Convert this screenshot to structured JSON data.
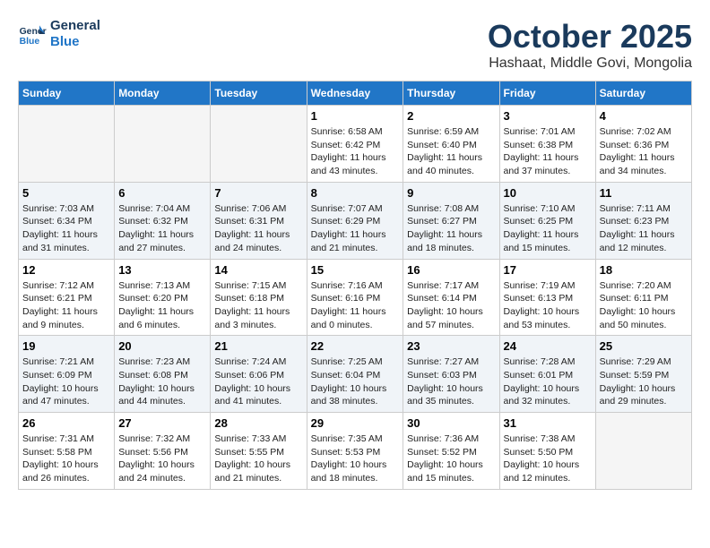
{
  "header": {
    "logo_line1": "General",
    "logo_line2": "Blue",
    "month_title": "October 2025",
    "location": "Hashaat, Middle Govi, Mongolia"
  },
  "days_of_week": [
    "Sunday",
    "Monday",
    "Tuesday",
    "Wednesday",
    "Thursday",
    "Friday",
    "Saturday"
  ],
  "weeks": [
    [
      {
        "day": "",
        "empty": true
      },
      {
        "day": "",
        "empty": true
      },
      {
        "day": "",
        "empty": true
      },
      {
        "day": "1",
        "sunrise": "6:58 AM",
        "sunset": "6:42 PM",
        "daylight": "11 hours and 43 minutes."
      },
      {
        "day": "2",
        "sunrise": "6:59 AM",
        "sunset": "6:40 PM",
        "daylight": "11 hours and 40 minutes."
      },
      {
        "day": "3",
        "sunrise": "7:01 AM",
        "sunset": "6:38 PM",
        "daylight": "11 hours and 37 minutes."
      },
      {
        "day": "4",
        "sunrise": "7:02 AM",
        "sunset": "6:36 PM",
        "daylight": "11 hours and 34 minutes."
      }
    ],
    [
      {
        "day": "5",
        "sunrise": "7:03 AM",
        "sunset": "6:34 PM",
        "daylight": "11 hours and 31 minutes."
      },
      {
        "day": "6",
        "sunrise": "7:04 AM",
        "sunset": "6:32 PM",
        "daylight": "11 hours and 27 minutes."
      },
      {
        "day": "7",
        "sunrise": "7:06 AM",
        "sunset": "6:31 PM",
        "daylight": "11 hours and 24 minutes."
      },
      {
        "day": "8",
        "sunrise": "7:07 AM",
        "sunset": "6:29 PM",
        "daylight": "11 hours and 21 minutes."
      },
      {
        "day": "9",
        "sunrise": "7:08 AM",
        "sunset": "6:27 PM",
        "daylight": "11 hours and 18 minutes."
      },
      {
        "day": "10",
        "sunrise": "7:10 AM",
        "sunset": "6:25 PM",
        "daylight": "11 hours and 15 minutes."
      },
      {
        "day": "11",
        "sunrise": "7:11 AM",
        "sunset": "6:23 PM",
        "daylight": "11 hours and 12 minutes."
      }
    ],
    [
      {
        "day": "12",
        "sunrise": "7:12 AM",
        "sunset": "6:21 PM",
        "daylight": "11 hours and 9 minutes."
      },
      {
        "day": "13",
        "sunrise": "7:13 AM",
        "sunset": "6:20 PM",
        "daylight": "11 hours and 6 minutes."
      },
      {
        "day": "14",
        "sunrise": "7:15 AM",
        "sunset": "6:18 PM",
        "daylight": "11 hours and 3 minutes."
      },
      {
        "day": "15",
        "sunrise": "7:16 AM",
        "sunset": "6:16 PM",
        "daylight": "11 hours and 0 minutes."
      },
      {
        "day": "16",
        "sunrise": "7:17 AM",
        "sunset": "6:14 PM",
        "daylight": "10 hours and 57 minutes."
      },
      {
        "day": "17",
        "sunrise": "7:19 AM",
        "sunset": "6:13 PM",
        "daylight": "10 hours and 53 minutes."
      },
      {
        "day": "18",
        "sunrise": "7:20 AM",
        "sunset": "6:11 PM",
        "daylight": "10 hours and 50 minutes."
      }
    ],
    [
      {
        "day": "19",
        "sunrise": "7:21 AM",
        "sunset": "6:09 PM",
        "daylight": "10 hours and 47 minutes."
      },
      {
        "day": "20",
        "sunrise": "7:23 AM",
        "sunset": "6:08 PM",
        "daylight": "10 hours and 44 minutes."
      },
      {
        "day": "21",
        "sunrise": "7:24 AM",
        "sunset": "6:06 PM",
        "daylight": "10 hours and 41 minutes."
      },
      {
        "day": "22",
        "sunrise": "7:25 AM",
        "sunset": "6:04 PM",
        "daylight": "10 hours and 38 minutes."
      },
      {
        "day": "23",
        "sunrise": "7:27 AM",
        "sunset": "6:03 PM",
        "daylight": "10 hours and 35 minutes."
      },
      {
        "day": "24",
        "sunrise": "7:28 AM",
        "sunset": "6:01 PM",
        "daylight": "10 hours and 32 minutes."
      },
      {
        "day": "25",
        "sunrise": "7:29 AM",
        "sunset": "5:59 PM",
        "daylight": "10 hours and 29 minutes."
      }
    ],
    [
      {
        "day": "26",
        "sunrise": "7:31 AM",
        "sunset": "5:58 PM",
        "daylight": "10 hours and 26 minutes."
      },
      {
        "day": "27",
        "sunrise": "7:32 AM",
        "sunset": "5:56 PM",
        "daylight": "10 hours and 24 minutes."
      },
      {
        "day": "28",
        "sunrise": "7:33 AM",
        "sunset": "5:55 PM",
        "daylight": "10 hours and 21 minutes."
      },
      {
        "day": "29",
        "sunrise": "7:35 AM",
        "sunset": "5:53 PM",
        "daylight": "10 hours and 18 minutes."
      },
      {
        "day": "30",
        "sunrise": "7:36 AM",
        "sunset": "5:52 PM",
        "daylight": "10 hours and 15 minutes."
      },
      {
        "day": "31",
        "sunrise": "7:38 AM",
        "sunset": "5:50 PM",
        "daylight": "10 hours and 12 minutes."
      },
      {
        "day": "",
        "empty": true
      }
    ]
  ]
}
